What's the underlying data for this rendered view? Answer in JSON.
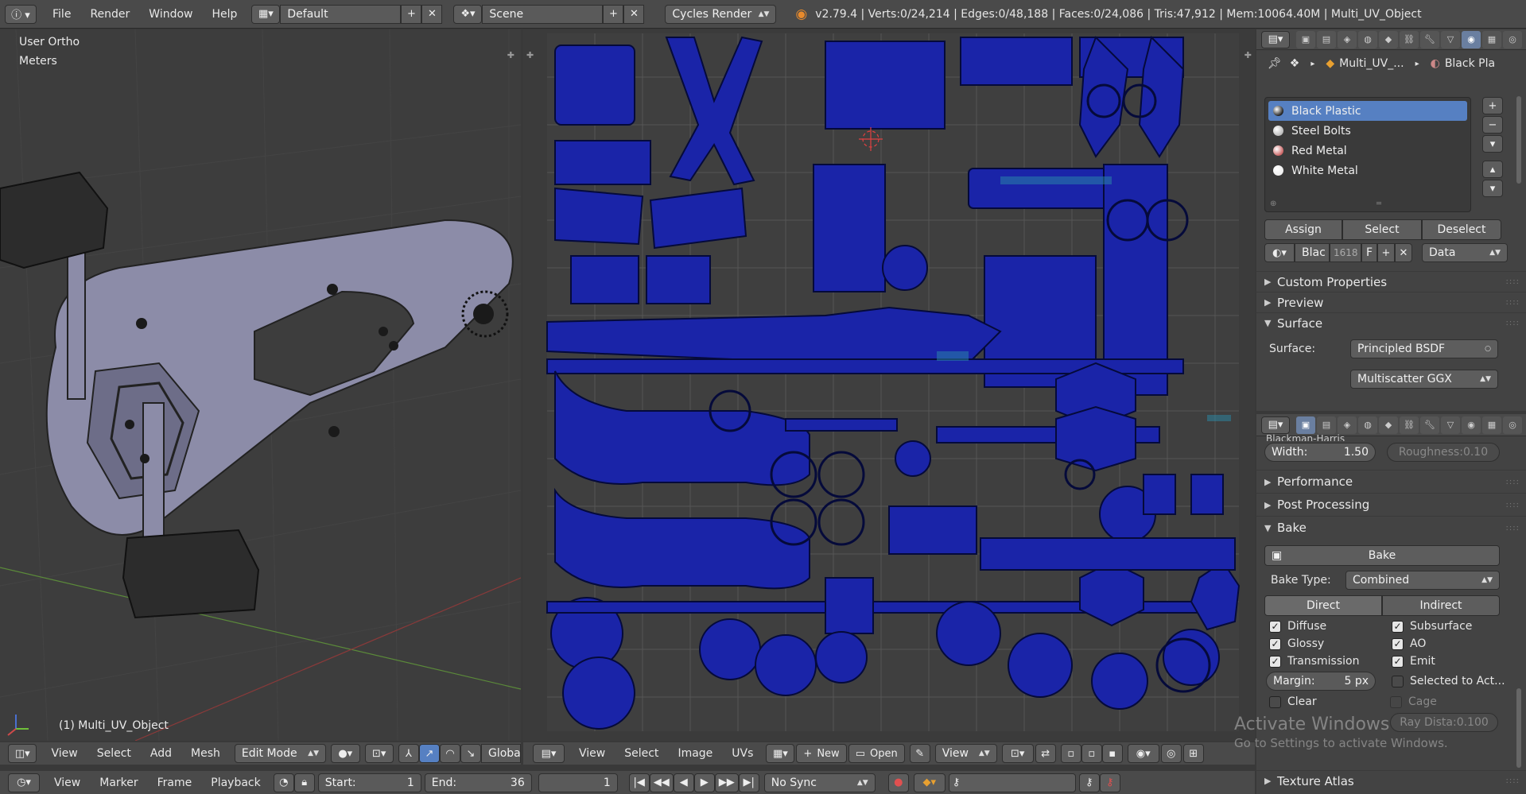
{
  "info": {
    "menus": [
      "File",
      "Render",
      "Window",
      "Help"
    ],
    "layout": "Default",
    "scene": "Scene",
    "engine": "Cycles Render",
    "stats": "v2.79.4 | Verts:0/24,214 | Edges:0/48,188 | Faces:0/24,086 | Tris:47,912 | Mem:10064.40M | Multi_UV_Object"
  },
  "viewport3d": {
    "view_name": "User Ortho",
    "units": "Meters",
    "object_label": "(1) Multi_UV_Object",
    "menus": [
      "View",
      "Select",
      "Add",
      "Mesh"
    ],
    "mode": "Edit Mode",
    "orientation": "Globa"
  },
  "uv_editor": {
    "menus": [
      "View",
      "Select",
      "Image",
      "UVs"
    ],
    "new_label": "New",
    "open_label": "Open",
    "view_label": "View"
  },
  "timeline": {
    "menus": [
      "View",
      "Marker",
      "Frame",
      "Playback"
    ],
    "start_label": "Start:",
    "start_value": "1",
    "end_label": "End:",
    "end_value": "36",
    "current_frame": "1",
    "sync": "No Sync"
  },
  "material_panel": {
    "breadcrumb_object": "Multi_UV_...",
    "breadcrumb_material": "Black Pla",
    "slots": [
      "Black Plastic",
      "Steel Bolts",
      "Red Metal",
      "White Metal"
    ],
    "selected_slot": 0,
    "assign": "Assign",
    "select": "Select",
    "deselect": "Deselect",
    "mat_name": "Blac",
    "mat_users": "1618",
    "mat_fake": "F",
    "link": "Data",
    "custom_properties": "Custom Properties",
    "preview": "Preview",
    "surface_section": "Surface",
    "surface_label": "Surface:",
    "surface_value": "Principled BSDF",
    "distribution": "Multiscatter GGX"
  },
  "render_panel": {
    "filter_type": "Blackman-Harris",
    "width_label": "Width:",
    "width_value": "1.50",
    "roughness_label": "Roughness:",
    "roughness_value": "0.10",
    "performance": "Performance",
    "post_processing": "Post Processing",
    "bake_section": "Bake",
    "bake_button": "Bake",
    "bake_type_label": "Bake Type:",
    "bake_type": "Combined",
    "direct": "Direct",
    "indirect": "Indirect",
    "checks_left": [
      "Diffuse",
      "Glossy",
      "Transmission"
    ],
    "checks_right": [
      "Subsurface",
      "AO",
      "Emit"
    ],
    "margin_label": "Margin:",
    "margin_value": "5 px",
    "selected_to_active": "Selected to Act...",
    "clear": "Clear",
    "cage": "Cage",
    "ray_distance_label": "Ray Dista:",
    "ray_distance_value": "0.100",
    "texture_atlas": "Texture Atlas"
  },
  "watermark": {
    "line1": "Activate Windows",
    "line2": "Go to Settings to activate Windows."
  },
  "colors": {
    "uv_fill": "#1a24a8",
    "uv_edge": "#050a3a",
    "selected_slot": "#5680c2",
    "mesh": "#8c8ca8"
  }
}
